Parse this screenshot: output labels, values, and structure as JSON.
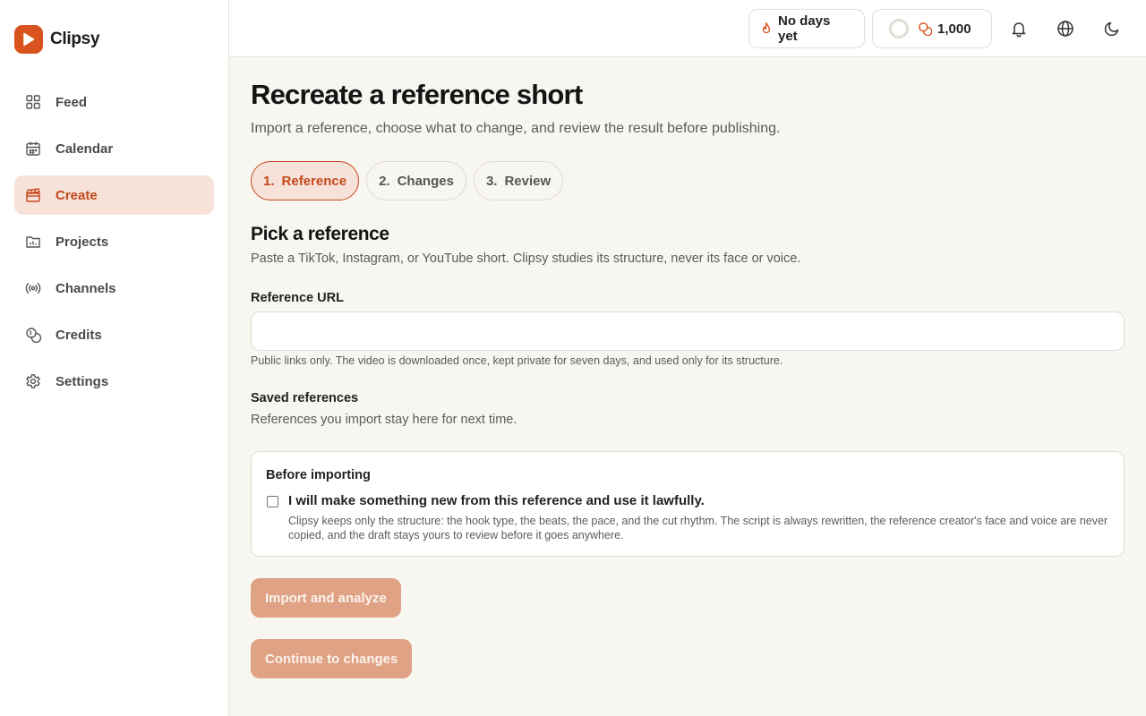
{
  "brand": {
    "name": "Clipsy"
  },
  "sidebar": {
    "items": [
      {
        "label": "Feed",
        "icon": "grid-icon"
      },
      {
        "label": "Calendar",
        "icon": "calendar-icon"
      },
      {
        "label": "Create",
        "icon": "clapperboard-icon",
        "active": true
      },
      {
        "label": "Projects",
        "icon": "folder-chart-icon"
      },
      {
        "label": "Channels",
        "icon": "broadcast-icon"
      },
      {
        "label": "Credits",
        "icon": "coins-icon"
      },
      {
        "label": "Settings",
        "icon": "gear-icon"
      }
    ]
  },
  "topbar": {
    "streak_label": "No days yet",
    "credits_value": "1,000"
  },
  "main": {
    "title": "Recreate a reference short",
    "subtitle": "Import a reference, choose what to change, and review the result before publishing.",
    "steps": [
      {
        "num": "1.",
        "label": "Reference",
        "active": true
      },
      {
        "num": "2.",
        "label": "Changes"
      },
      {
        "num": "3.",
        "label": "Review"
      }
    ],
    "section_title": "Pick a reference",
    "section_sub": "Paste a TikTok, Instagram, or YouTube short. Clipsy studies its structure, never its face or voice.",
    "url_label": "Reference URL",
    "url_value": "",
    "url_help": "Public links only. The video is downloaded once, kept private for seven days, and used only for its structure.",
    "saved_title": "Saved references",
    "saved_sub": "References you import stay here for next time.",
    "consent": {
      "title": "Before importing",
      "checkbox_label": "I will make something new from this reference and use it lawfully.",
      "checked": false,
      "description": "Clipsy keeps only the structure: the hook type, the beats, the pace, and the cut rhythm. The script is always rewritten, the reference creator's face and voice are never copied, and the draft stays yours to review before it goes anywhere."
    },
    "import_button": "Import and analyze",
    "continue_button": "Continue to changes"
  },
  "colors": {
    "accent": "#c4471a",
    "brand": "#d9531e",
    "button_disabled": "#e0a285",
    "active_bg": "#f6e2d9"
  }
}
